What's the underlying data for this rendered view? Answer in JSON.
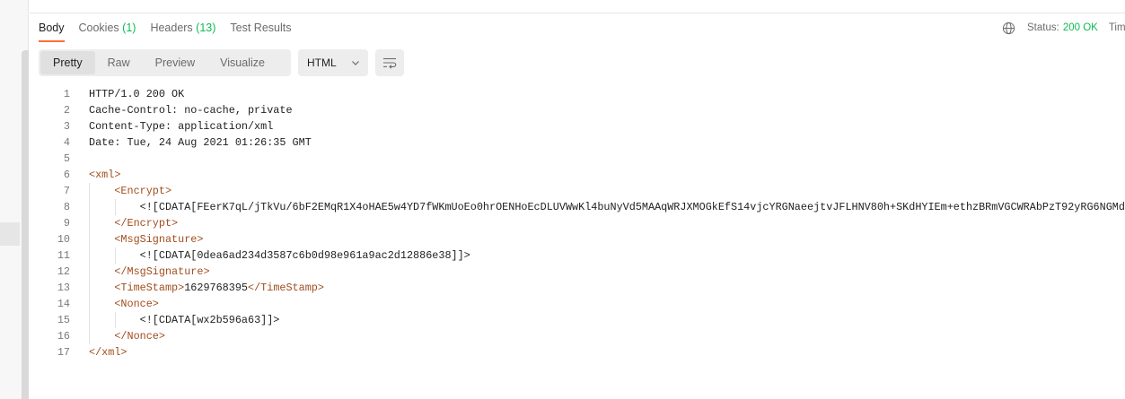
{
  "tabs": [
    {
      "label": "Body",
      "count": ""
    },
    {
      "label": "Cookies",
      "count": "(1)"
    },
    {
      "label": "Headers",
      "count": "(13)"
    },
    {
      "label": "Test Results",
      "count": ""
    }
  ],
  "status": {
    "label": "Status:",
    "value": "200 OK",
    "time_label": "Time"
  },
  "format": {
    "pretty": "Pretty",
    "raw": "Raw",
    "preview": "Preview",
    "visualize": "Visualize"
  },
  "language": {
    "selected": "HTML"
  },
  "colors": {
    "accent": "#ff6c37",
    "success": "#0cbb52",
    "tag": "#a24d1d"
  },
  "lines": [
    {
      "n": "1",
      "text": "HTTP/1.0 200 OK"
    },
    {
      "n": "2",
      "text": "Cache-Control: no-cache, private"
    },
    {
      "n": "3",
      "text": "Content-Type: application/xml"
    },
    {
      "n": "4",
      "text": "Date: Tue, 24 Aug 2021 01:26:35 GMT"
    },
    {
      "n": "5",
      "text": ""
    },
    {
      "n": "6",
      "open": "<xml>",
      "text": "",
      "close": ""
    },
    {
      "n": "7",
      "indent": "    ",
      "open": "<Encrypt>",
      "text": "",
      "close": ""
    },
    {
      "n": "8",
      "indent": "        ",
      "text": "<![CDATA[FEerK7qL/jTkVu/6bF2EMqR1X4oHAE5w4YD7fWKmUoEo0hrOENHoEcDLUVWwKl4buNyVd5MAAqWRJXMOGkEfS14vjcYRGNaeejtvJFLHNV80h+SKdHYIEm+ethzBRmVGCWRAbPzT92yRG6NGMd"
    },
    {
      "n": "9",
      "indent": "    ",
      "open": "</Encrypt>",
      "text": "",
      "close": ""
    },
    {
      "n": "10",
      "indent": "    ",
      "open": "<MsgSignature>",
      "text": "",
      "close": ""
    },
    {
      "n": "11",
      "indent": "        ",
      "text": "<![CDATA[0dea6ad234d3587c6b0d98e961a9ac2d12886e38]]>"
    },
    {
      "n": "12",
      "indent": "    ",
      "open": "</MsgSignature>",
      "text": "",
      "close": ""
    },
    {
      "n": "13",
      "indent": "    ",
      "open": "<TimeStamp>",
      "text": "1629768395",
      "close": "</TimeStamp>"
    },
    {
      "n": "14",
      "indent": "    ",
      "open": "<Nonce>",
      "text": "",
      "close": ""
    },
    {
      "n": "15",
      "indent": "        ",
      "text": "<![CDATA[wx2b596a63]]>"
    },
    {
      "n": "16",
      "indent": "    ",
      "open": "</Nonce>",
      "text": "",
      "close": ""
    },
    {
      "n": "17",
      "open": "</xml>",
      "text": "",
      "close": ""
    }
  ]
}
